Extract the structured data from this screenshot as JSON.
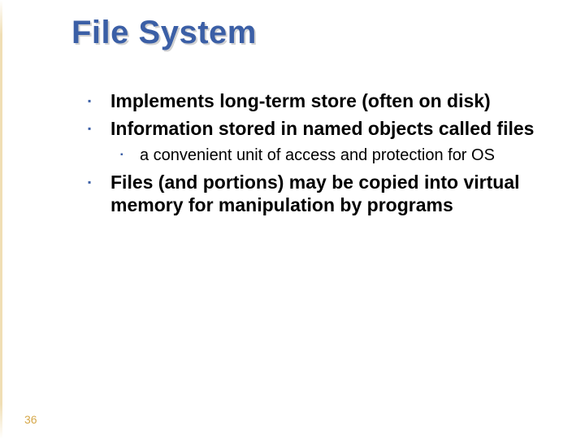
{
  "title": "File System",
  "bullets": {
    "b1": "Implements long-term store (often on disk)",
    "b2": "Information stored in named objects called files",
    "b2a": "a convenient unit of access and protection for OS",
    "b3": "Files (and portions) may be copied into virtual memory for manipulation by programs"
  },
  "glyphs": {
    "square": "▪"
  },
  "page_number": "36"
}
